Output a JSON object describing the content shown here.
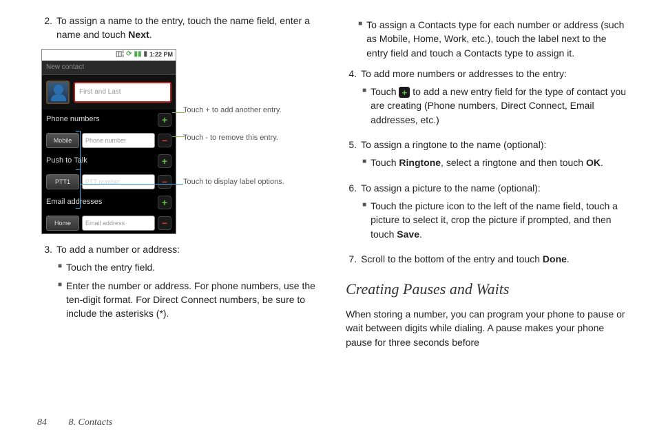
{
  "left": {
    "step2_num": "2.",
    "step2": "To assign a name to the entry, touch the name field, enter a name and touch ",
    "step2_kw": "Next",
    "step2_post": ".",
    "step3_num": "3.",
    "step3": "To add a number or address:",
    "step3_sub1": "Touch the entry field.",
    "step3_sub2": "Enter the number or address. For phone numbers, use the ten-digit format. For Direct Connect numbers, be sure to include the asterisks (*)."
  },
  "right": {
    "sub_contacts_type": "To assign a Contacts type for each number or address (such as Mobile, Home, Work, etc.), touch the label next to the entry field and touch a Contacts type to assign it.",
    "step4_num": "4.",
    "step4": "To add more numbers or addresses to the entry:",
    "step4_sub1_pre": "Touch ",
    "step4_sub1_post": " to add a new entry field for the type of contact you are creating (Phone numbers, Direct Connect, Email addresses, etc.)",
    "step5_num": "5.",
    "step5": "To assign a ringtone to the name (optional):",
    "step5_sub1_pre": "Touch ",
    "step5_sub1_kw1": "Ringtone",
    "step5_sub1_mid": ", select a ringtone and then touch ",
    "step5_sub1_kw2": "OK",
    "step5_sub1_post": ".",
    "step6_num": "6.",
    "step6": "To assign a picture to the name (optional):",
    "step6_sub1_pre": "Touch the picture icon to the left of the name field, touch a picture to select it, crop the picture if prompted, and then touch ",
    "step6_sub1_kw": "Save",
    "step6_sub1_post": ".",
    "step7_num": "7.",
    "step7_pre": "Scroll to the bottom of the entry and touch ",
    "step7_kw": "Done",
    "step7_post": ".",
    "heading": "Creating Pauses and Waits",
    "para": "When storing a number, you can program your phone to pause or wait between digits while dialing. A pause makes your phone pause for three seconds before"
  },
  "device": {
    "time": "1:22 PM",
    "title": "New contact",
    "name_placeholder": "First and Last",
    "sec_phone": "Phone numbers",
    "mobile_label": "Mobile",
    "phone_placeholder": "Phone number",
    "sec_ptt": "Push to Talk",
    "ptt_label": "PTT1",
    "ptt_placeholder": "PTT number",
    "sec_email": "Email addresses",
    "home_label": "Home",
    "email_placeholder": "Email address"
  },
  "callouts": {
    "c1": "Touch + to add another entry.",
    "c2": "Touch - to remove this entry.",
    "c3": "Touch to display label options."
  },
  "footer": {
    "page": "84",
    "chapter": "8. Contacts"
  }
}
